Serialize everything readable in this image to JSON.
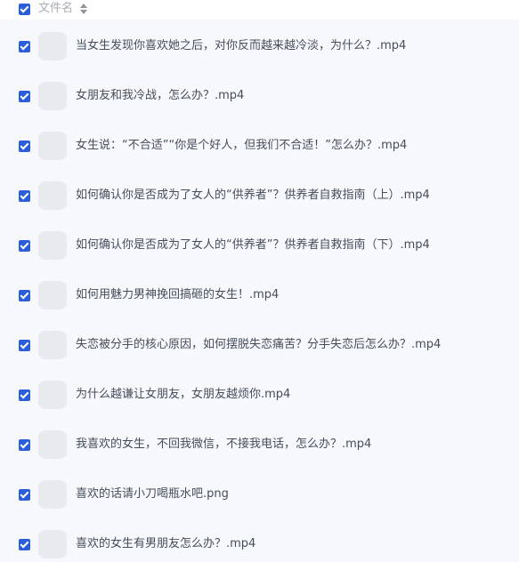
{
  "header": {
    "column_label": "文件名",
    "checkbox_checked": true,
    "sort_icon": "sort-icon"
  },
  "files": [
    {
      "name": "当女生发现你喜欢她之后，对你反而越来越冷淡，为什么？.mp4",
      "checked": true
    },
    {
      "name": "女朋友和我冷战，怎么办？.mp4",
      "checked": true
    },
    {
      "name": "女生说：“不合适”“你是个好人，但我们不合适！”怎么办？.mp4",
      "checked": true
    },
    {
      "name": "如何确认你是否成为了女人的“供养者”？供养者自救指南（上）.mp4",
      "checked": true
    },
    {
      "name": "如何确认你是否成为了女人的“供养者”？供养者自救指南（下）.mp4",
      "checked": true
    },
    {
      "name": "如何用魅力男神挽回搞砸的女生！.mp4",
      "checked": true
    },
    {
      "name": "失恋被分手的核心原因，如何摆脱失恋痛苦？分手失恋后怎么办？.mp4",
      "checked": true
    },
    {
      "name": "为什么越谦让女朋友，女朋友越烦你.mp4",
      "checked": true
    },
    {
      "name": "我喜欢的女生，不回我微信，不接我电话，怎么办？.mp4",
      "checked": true
    },
    {
      "name": "喜欢的话请小刀喝瓶水吧.png",
      "checked": true
    },
    {
      "name": "喜欢的女生有男朋友怎么办？.mp4",
      "checked": true
    }
  ],
  "colors": {
    "checkbox": "#2b5fd9",
    "list_background": "#f7f8fc",
    "thumbnail": "#e9eaee",
    "text": "#454d5a",
    "header_text": "#a7abb3"
  }
}
